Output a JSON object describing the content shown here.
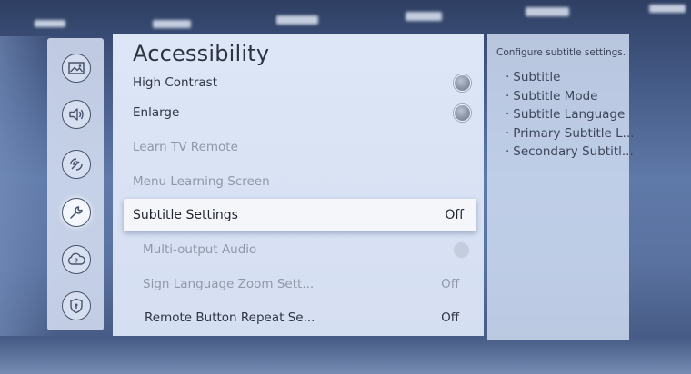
{
  "nav": {
    "items": [
      {
        "icon": "picture-icon",
        "active": false
      },
      {
        "icon": "sound-icon",
        "active": false
      },
      {
        "icon": "broadcasting-icon",
        "active": false
      },
      {
        "icon": "general-wrench-icon",
        "active": true
      },
      {
        "icon": "support-icon",
        "active": false
      },
      {
        "icon": "privacy-shield-icon",
        "active": false
      }
    ]
  },
  "panel": {
    "title": "Accessibility",
    "items": [
      {
        "label": "High Contrast",
        "control": "toggle",
        "enabled": true
      },
      {
        "label": "Enlarge",
        "control": "toggle",
        "enabled": true
      },
      {
        "label": "Learn TV Remote",
        "enabled": false
      },
      {
        "label": "Menu Learning Screen",
        "enabled": false
      },
      {
        "label": "Subtitle Settings",
        "value": "Off",
        "selected": true,
        "enabled": true
      },
      {
        "label": "Multi-output Audio",
        "control": "toggle",
        "enabled": false
      },
      {
        "label": "Sign Language Zoom Sett...",
        "value": "Off",
        "enabled": false
      },
      {
        "label": "Remote Button Repeat Se...",
        "value": "Off",
        "enabled": true
      }
    ]
  },
  "info": {
    "heading": "Configure subtitle settings.",
    "items": [
      "Subtitle",
      "Subtitle Mode",
      "Subtitle Language",
      "Primary Subtitle L...",
      "Secondary Subtitl..."
    ]
  }
}
